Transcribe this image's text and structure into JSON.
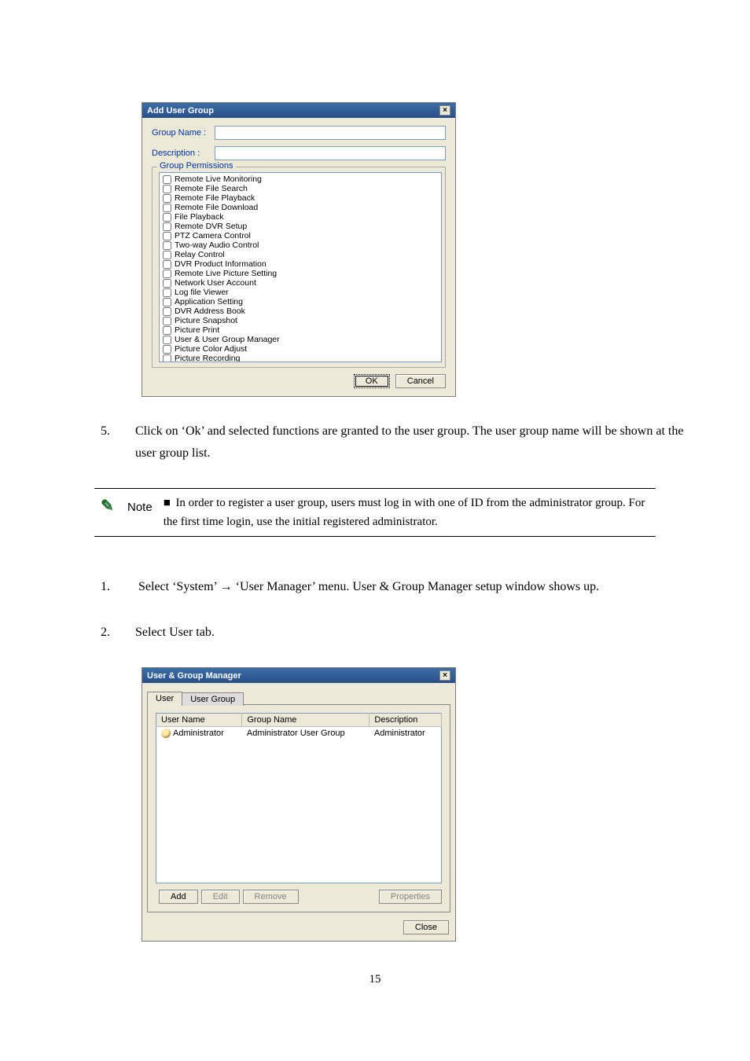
{
  "dialog1": {
    "title": "Add User Group",
    "close": "×",
    "groupNameLabel": "Group Name :",
    "descriptionLabel": "Description :",
    "permissionsLabel": "Group Permissions",
    "permissions": [
      "Remote Live Monitoring",
      "Remote File Search",
      "Remote File Playback",
      "Remote File Download",
      "File Playback",
      "Remote DVR Setup",
      "PTZ Camera Control",
      "Two-way Audio Control",
      "Relay Control",
      "DVR Product Information",
      "Remote Live Picture Setting",
      "Network User Account",
      "Log file Viewer",
      "Application Setting",
      "DVR Address Book",
      "Picture Snapshot",
      "Picture Print",
      "User & User Group Manager",
      "Picture Color Adjust",
      "Picture Recording"
    ],
    "ok": "OK",
    "cancel": "Cancel"
  },
  "step5": "Click on ‘Ok’ and selected functions are granted to the user group. The user group name will be shown at the user group list.",
  "note": {
    "label": "Note",
    "line1": "In order to register a user group, users must log in with one of ID from the administrator group. For the first time login, use the initial registered administrator."
  },
  "step1": "Select ‘System’ → ‘User Manager’ menu. User & Group Manager setup window shows up.",
  "step2": "Select User tab.",
  "dialog2": {
    "title": "User & Group Manager",
    "close": "×",
    "tabUser": "User",
    "tabUserGroup": "User Group",
    "colUserName": "User Name",
    "colGroupName": "Group Name",
    "colDescription": "Description",
    "rowUser": "Administrator",
    "rowGroup": "Administrator User Group",
    "rowDesc": "Administrator",
    "add": "Add",
    "edit": "Edit",
    "remove": "Remove",
    "properties": "Properties",
    "closeBtn": "Close"
  },
  "pageNum": "15"
}
